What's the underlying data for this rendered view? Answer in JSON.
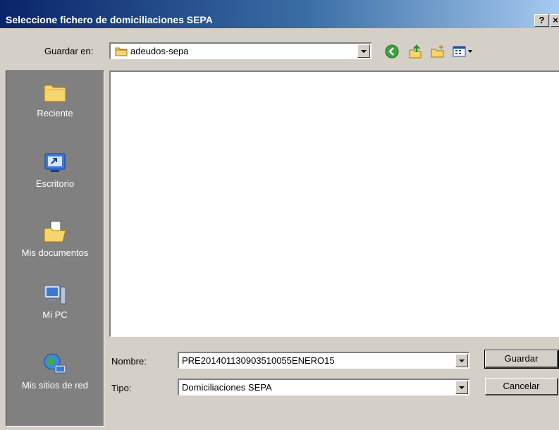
{
  "dialog": {
    "title": "Seleccione fichero de domiciliaciones SEPA",
    "help_label": "?",
    "close_label": "×"
  },
  "toolbar": {
    "save_in_label": "Guardar en:",
    "current_folder": "adeudos-sepa",
    "icons": [
      "back-icon",
      "up-folder-icon",
      "new-folder-icon",
      "view-menu-icon"
    ]
  },
  "places": [
    {
      "label": "Reciente",
      "icon": "recent-folder-icon"
    },
    {
      "label": "Escritorio",
      "icon": "desktop-icon"
    },
    {
      "label": "Mis documentos",
      "icon": "my-documents-icon"
    },
    {
      "label": "Mi PC",
      "icon": "my-computer-icon"
    },
    {
      "label": "Mis sitios de red",
      "icon": "network-places-icon"
    }
  ],
  "file_name": {
    "label": "Nombre:",
    "value": "PRE201401130903510055ENERO15"
  },
  "file_type": {
    "label": "Tipo:",
    "value": "Domiciliaciones SEPA"
  },
  "buttons": {
    "save": "Guardar",
    "cancel": "Cancelar"
  }
}
